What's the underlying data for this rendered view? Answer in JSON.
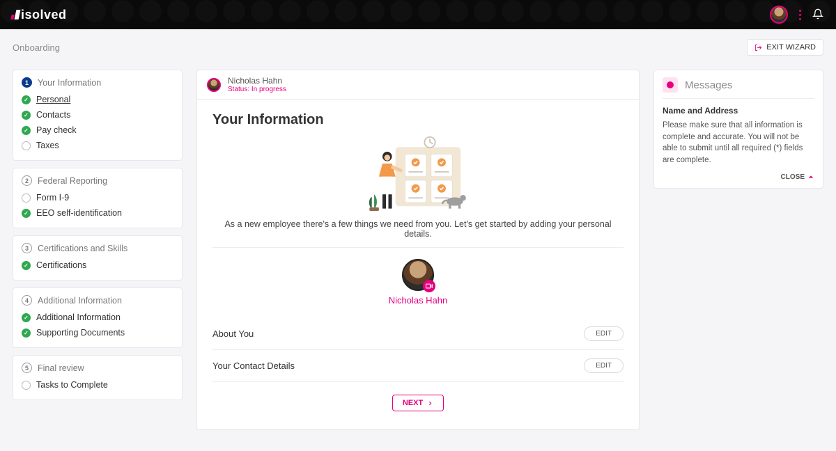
{
  "brand": {
    "name": "isolved"
  },
  "header": {
    "breadcrumb": "Onboarding",
    "exit_label": "EXIT WIZARD"
  },
  "user": {
    "name": "Nicholas Hahn",
    "status": "Status: In progress"
  },
  "sidebar": {
    "sections": [
      {
        "number": "1",
        "title": "Your Information",
        "active": true,
        "items": [
          {
            "label": "Personal",
            "status": "done",
            "current": true
          },
          {
            "label": "Contacts",
            "status": "done"
          },
          {
            "label": "Pay check",
            "status": "done"
          },
          {
            "label": "Taxes",
            "status": "todo"
          }
        ]
      },
      {
        "number": "2",
        "title": "Federal Reporting",
        "items": [
          {
            "label": "Form I-9",
            "status": "todo"
          },
          {
            "label": "EEO self-identification",
            "status": "done"
          }
        ]
      },
      {
        "number": "3",
        "title": "Certifications and Skills",
        "items": [
          {
            "label": "Certifications",
            "status": "done"
          }
        ]
      },
      {
        "number": "4",
        "title": "Additional Information",
        "items": [
          {
            "label": "Additional Information",
            "status": "done"
          },
          {
            "label": "Supporting Documents",
            "status": "done"
          }
        ]
      },
      {
        "number": "5",
        "title": "Final review",
        "items": [
          {
            "label": "Tasks to Complete",
            "status": "todo"
          }
        ]
      }
    ]
  },
  "main": {
    "title": "Your Information",
    "intro": "As a new employee there's a few things we need from you. Let's get started by adding your personal details.",
    "profile_name": "Nicholas Hahn",
    "sections": [
      {
        "label": "About You",
        "action": "EDIT"
      },
      {
        "label": "Your Contact Details",
        "action": "EDIT"
      }
    ],
    "next_label": "NEXT"
  },
  "messages": {
    "title": "Messages",
    "subject": "Name and Address",
    "body": "Please make sure that all information is complete and accurate. You will not be able to submit until all required (*) fields are complete.",
    "close": "CLOSE"
  }
}
